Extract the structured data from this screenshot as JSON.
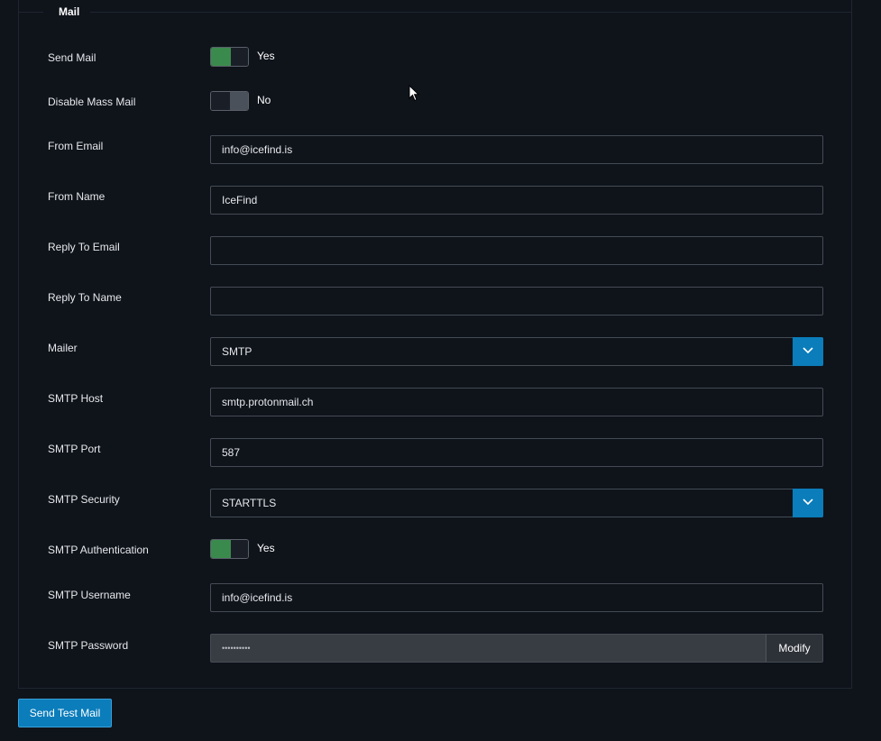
{
  "section": {
    "legend": "Mail"
  },
  "fields": {
    "send_mail": {
      "label": "Send Mail",
      "state": "on",
      "state_text": "Yes"
    },
    "disable_mass_mail": {
      "label": "Disable Mass Mail",
      "state": "off",
      "state_text": "No"
    },
    "from_email": {
      "label": "From Email",
      "value": "info@icefind.is"
    },
    "from_name": {
      "label": "From Name",
      "value": "IceFind"
    },
    "reply_to_email": {
      "label": "Reply To Email",
      "value": ""
    },
    "reply_to_name": {
      "label": "Reply To Name",
      "value": ""
    },
    "mailer": {
      "label": "Mailer",
      "selected": "SMTP"
    },
    "smtp_host": {
      "label": "SMTP Host",
      "value": "smtp.protonmail.ch"
    },
    "smtp_port": {
      "label": "SMTP Port",
      "value": "587"
    },
    "smtp_security": {
      "label": "SMTP Security",
      "selected": "STARTTLS"
    },
    "smtp_authentication": {
      "label": "SMTP Authentication",
      "state": "on",
      "state_text": "Yes"
    },
    "smtp_username": {
      "label": "SMTP Username",
      "value": "info@icefind.is"
    },
    "smtp_password": {
      "label": "SMTP Password",
      "masked_value": "••••••••••",
      "modify_label": "Modify"
    }
  },
  "actions": {
    "send_test_mail_label": "Send Test Mail"
  },
  "colors": {
    "background": "#0f141b",
    "toggle_on": "#3b8a4d",
    "accent": "#0b7dbb"
  }
}
